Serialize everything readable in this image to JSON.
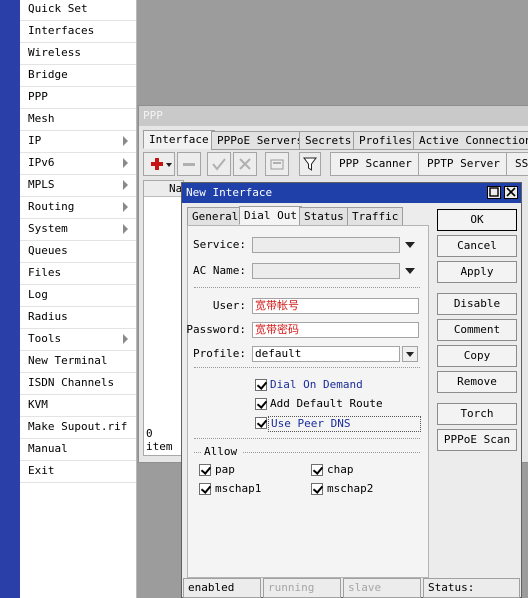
{
  "sidebar": {
    "items": [
      {
        "label": "Quick Set",
        "submenu": false
      },
      {
        "label": "Interfaces",
        "submenu": false
      },
      {
        "label": "Wireless",
        "submenu": false
      },
      {
        "label": "Bridge",
        "submenu": false
      },
      {
        "label": "PPP",
        "submenu": false
      },
      {
        "label": "Mesh",
        "submenu": false
      },
      {
        "label": "IP",
        "submenu": true
      },
      {
        "label": "IPv6",
        "submenu": true
      },
      {
        "label": "MPLS",
        "submenu": true
      },
      {
        "label": "Routing",
        "submenu": true
      },
      {
        "label": "System",
        "submenu": true
      },
      {
        "label": "Queues",
        "submenu": false
      },
      {
        "label": "Files",
        "submenu": false
      },
      {
        "label": "Log",
        "submenu": false
      },
      {
        "label": "Radius",
        "submenu": false
      },
      {
        "label": "Tools",
        "submenu": true
      },
      {
        "label": "New Terminal",
        "submenu": false
      },
      {
        "label": "ISDN Channels",
        "submenu": false
      },
      {
        "label": "KVM",
        "submenu": false
      },
      {
        "label": "Make Supout.rif",
        "submenu": false
      },
      {
        "label": "Manual",
        "submenu": false
      },
      {
        "label": "Exit",
        "submenu": false
      }
    ]
  },
  "ppp": {
    "title": "PPP",
    "tabs": [
      "Interface",
      "PPPoE Servers",
      "Secrets",
      "Profiles",
      "Active Connections"
    ],
    "active_tab": "Interface",
    "toolbar": {
      "scanner": "PPP Scanner",
      "pptp": "PPTP Server",
      "sstp": "SS"
    },
    "list_header": "Na",
    "items_count": "0 item"
  },
  "dialog": {
    "title": "New Interface",
    "tabs": [
      "General",
      "Dial Out",
      "Status",
      "Traffic"
    ],
    "active_tab": "Dial Out",
    "fields": {
      "service": {
        "label": "Service:",
        "value": ""
      },
      "ac_name": {
        "label": "AC Name:",
        "value": ""
      },
      "user": {
        "label": "User:",
        "value": "宽带帐号"
      },
      "password": {
        "label": "Password:",
        "value": "宽带密码"
      },
      "profile": {
        "label": "Profile:",
        "value": "default"
      }
    },
    "checks": {
      "dial_on_demand": {
        "label": "Dial On Demand",
        "checked": true
      },
      "add_default_route": {
        "label": "Add Default Route",
        "checked": true
      },
      "use_peer_dns": {
        "label": "Use Peer DNS",
        "checked": true
      }
    },
    "allow": {
      "title": "Allow",
      "pap": "pap",
      "chap": "chap",
      "mschap1": "mschap1",
      "mschap2": "mschap2"
    },
    "buttons": [
      "OK",
      "Cancel",
      "Apply",
      "Disable",
      "Comment",
      "Copy",
      "Remove",
      "Torch",
      "PPPoE Scan"
    ],
    "status_bar": {
      "state": "enabled",
      "running": "running",
      "slave": "slave",
      "status": "Status:"
    }
  },
  "colors": {
    "accent": "#1f40a8",
    "strip": "#2a3fa8",
    "desktop": "#9c9c9c",
    "filled_text": "#d21a1a"
  }
}
